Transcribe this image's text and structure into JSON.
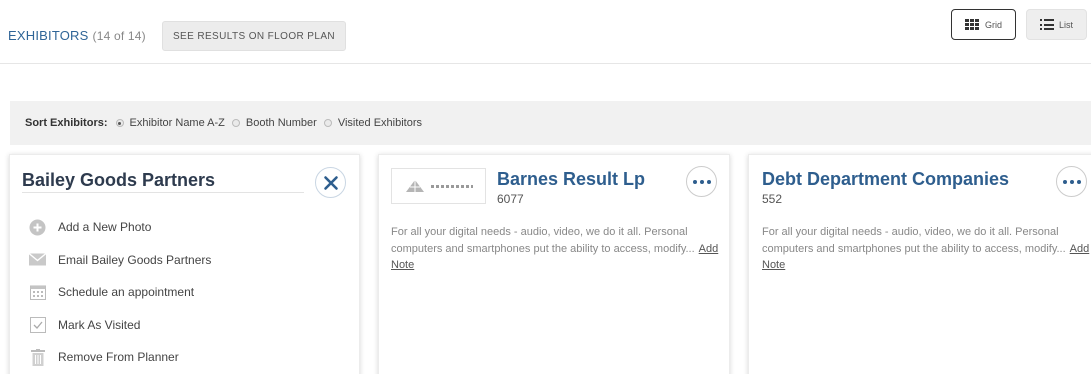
{
  "header": {
    "title": "EXHIBITORS",
    "count": "(14 of 14)",
    "floor_plan_button": "SEE RESULTS ON FLOOR PLAN",
    "view_grid_label": "Grid",
    "view_list_label": "List",
    "active_view": "Grid"
  },
  "sort": {
    "label": "Sort Exhibitors:",
    "options": [
      "Exhibitor Name A-Z",
      "Booth Number",
      "Visited Exhibitors"
    ],
    "selected": "Exhibitor Name A-Z"
  },
  "selected_card": {
    "name": "Bailey Goods Partners",
    "actions": [
      {
        "label": "Add a New Photo",
        "icon": "add-photo-icon"
      },
      {
        "label": "Email Bailey Goods Partners",
        "icon": "envelope-icon"
      },
      {
        "label": "Schedule an appointment",
        "icon": "calendar-icon"
      },
      {
        "label": "Mark As Visited",
        "icon": "checkbox-icon"
      },
      {
        "label": "Remove From Planner",
        "icon": "trash-icon"
      }
    ]
  },
  "exhibitors": [
    {
      "name": "Barnes Result Lp",
      "booth": "6077",
      "description": "For all your digital needs - audio, video, we do it all. Personal computers and smartphones put the ability to access, modify...",
      "add_note": "Add Note",
      "has_logo": true
    },
    {
      "name": "Debt Department Companies",
      "booth": "552",
      "description": "For all your digital needs - audio, video, we do it all. Personal computers and smartphones put the ability to access, modify...",
      "add_note": "Add Note",
      "has_logo": false
    }
  ],
  "colors": {
    "accent": "#2e5e8e",
    "title_dark": "#2e3b4e",
    "sort_bar_bg": "#f1f1f1"
  }
}
